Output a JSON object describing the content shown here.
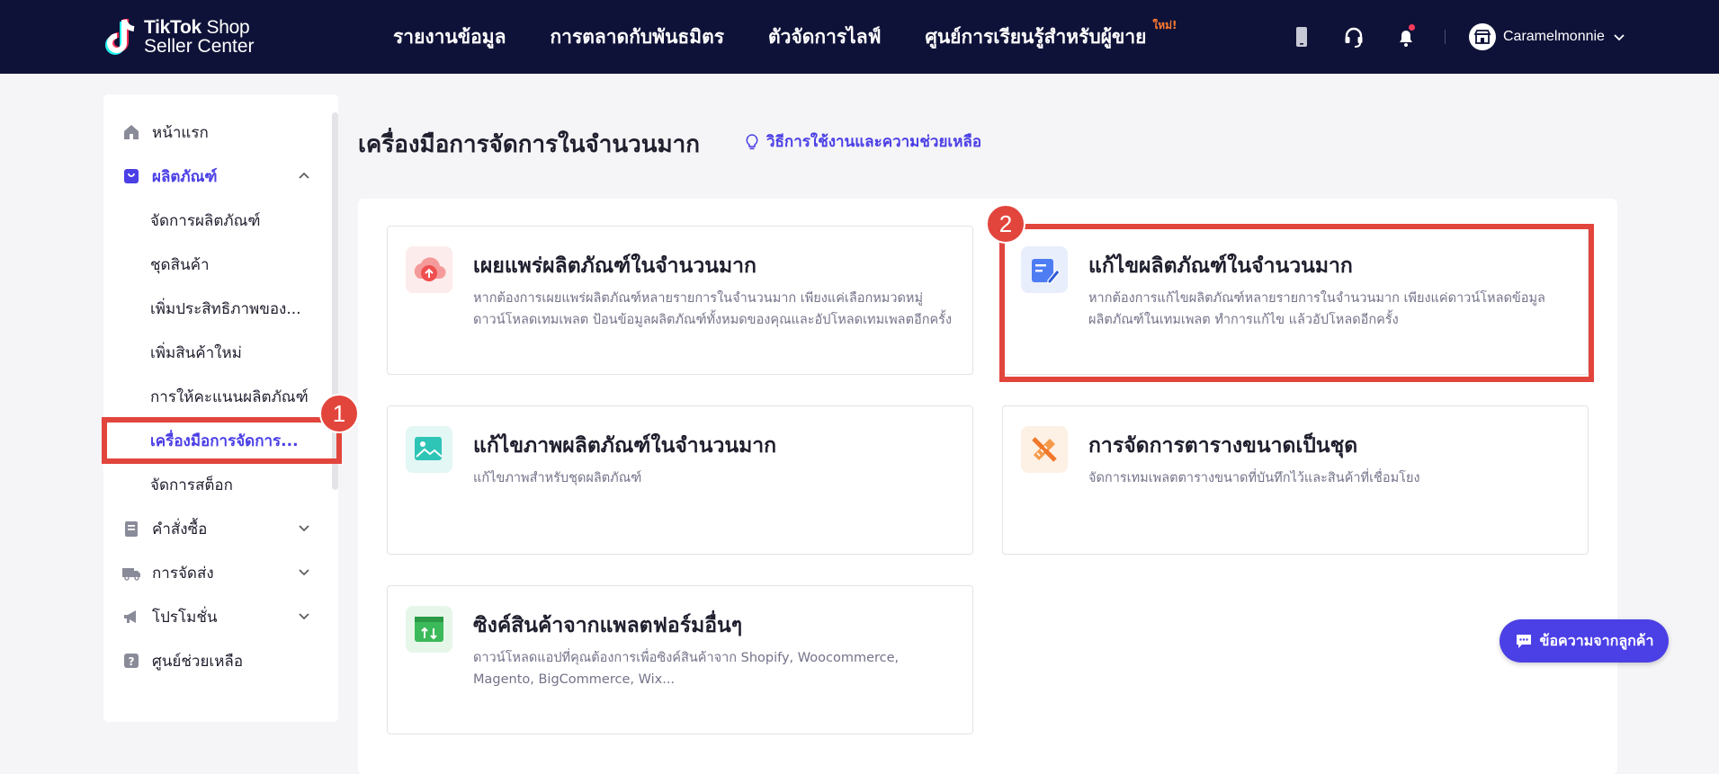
{
  "brand": {
    "line1_bold": "TikTok",
    "line1_rest": " Shop",
    "line2": "Seller Center"
  },
  "nav": [
    {
      "label": "รายงานข้อมูล"
    },
    {
      "label": "การตลาดกับพันธมิตร"
    },
    {
      "label": "ตัวจัดการไลฟ์"
    },
    {
      "label": "ศูนย์การเรียนรู้สำหรับผู้ขาย",
      "tag": "ใหม่!"
    }
  ],
  "account": {
    "name": "Caramelmonnie"
  },
  "sidebar": {
    "home": "หน้าแรก",
    "products": "ผลิตภัณฑ์",
    "product_items": [
      "จัดการผลิตภัณฑ์",
      "ชุดสินค้า",
      "เพิ่มประสิทธิภาพของ...",
      "เพิ่มสินค้าใหม่",
      "การให้คะแนนผลิตภัณฑ์",
      "เครื่องมือการจัดการ...",
      "จัดการสต็อก"
    ],
    "orders": "คำสั่งซื้อ",
    "shipping": "การจัดส่ง",
    "promotions": "โปรโมชั่น",
    "help_center": "ศูนย์ช่วยเหลือ"
  },
  "page": {
    "title": "เครื่องมือการจัดการในจำนวนมาก",
    "help_link": "วิธีการใช้งานและความช่วยเหลือ"
  },
  "cards": [
    {
      "title": "เผยแพร่ผลิตภัณฑ์ในจำนวนมาก",
      "desc": "หากต้องการเผยแพร่ผลิตภัณฑ์หลายรายการในจำนวนมาก เพียงแค่เลือกหมวดหมู่ ดาวน์โหลดเทมเพลต ป้อนข้อมูลผลิตภัณฑ์ทั้งหมดของคุณและอัปโหลดเทมเพลตอีกครั้ง"
    },
    {
      "title": "แก้ไขผลิตภัณฑ์ในจำนวนมาก",
      "desc": "หากต้องการแก้ไขผลิตภัณฑ์หลายรายการในจำนวนมาก เพียงแค่ดาวน์โหลดข้อมูลผลิตภัณฑ์ในเทมเพลต ทำการแก้ไข แล้วอัปโหลดอีกครั้ง"
    },
    {
      "title": "แก้ไขภาพผลิตภัณฑ์ในจำนวนมาก",
      "desc": "แก้ไขภาพสำหรับชุดผลิตภัณฑ์"
    },
    {
      "title": "การจัดการตารางขนาดเป็นชุด",
      "desc": "จัดการเทมเพลตตารางขนาดที่บันทึกไว้และสินค้าที่เชื่อมโยง"
    },
    {
      "title": "ซิงค์สินค้าจากแพลตฟอร์มอื่นๆ",
      "desc": "ดาวน์โหลดแอปที่คุณต้องการเพื่อซิงค์สินค้าจาก Shopify, Woocommerce, Magento, BigCommerce, Wix..."
    }
  ],
  "annotations": {
    "badge1": "1",
    "badge2": "2",
    "highlight_color": "#e2453c"
  },
  "chat_button": "ข้อความจากลูกค้า",
  "colors": {
    "topbar": "#0f1238",
    "accent": "#4b3fe6"
  }
}
